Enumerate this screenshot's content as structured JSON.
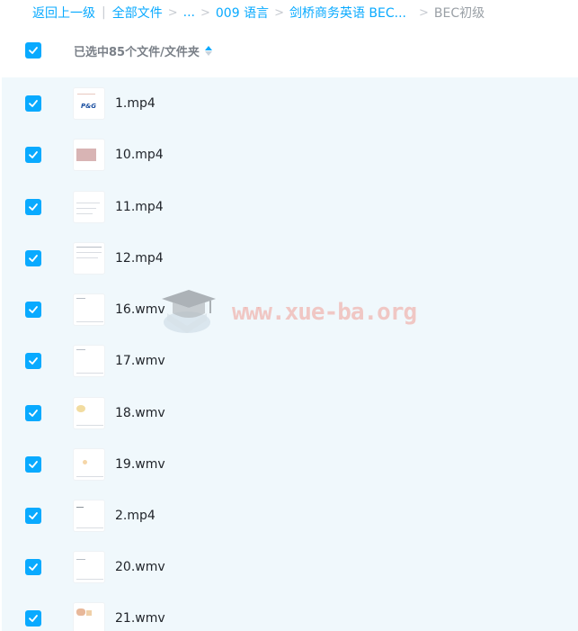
{
  "breadcrumb": {
    "back": "返回上一级",
    "all_files": "全部文件",
    "ellipsis": "...",
    "folder1": "009 语言",
    "folder2": "剑桥商务英语 BEC...",
    "current": "BEC初级"
  },
  "header": {
    "selected_text": "已选中85个文件/文件夹"
  },
  "watermark": "www.xue-ba.org",
  "files": [
    {
      "name": "1.mp4"
    },
    {
      "name": "10.mp4"
    },
    {
      "name": "11.mp4"
    },
    {
      "name": "12.mp4"
    },
    {
      "name": "16.wmv"
    },
    {
      "name": "17.wmv"
    },
    {
      "name": "18.wmv"
    },
    {
      "name": "19.wmv"
    },
    {
      "name": "2.mp4"
    },
    {
      "name": "20.wmv"
    },
    {
      "name": "21.wmv"
    }
  ],
  "colors": {
    "accent": "#09AAFF",
    "list_bg": "#f0f8fc"
  },
  "icons": {
    "checkbox": "checkmark-icon",
    "sort": "sort-icon",
    "separator": "chevron-right-icon"
  }
}
